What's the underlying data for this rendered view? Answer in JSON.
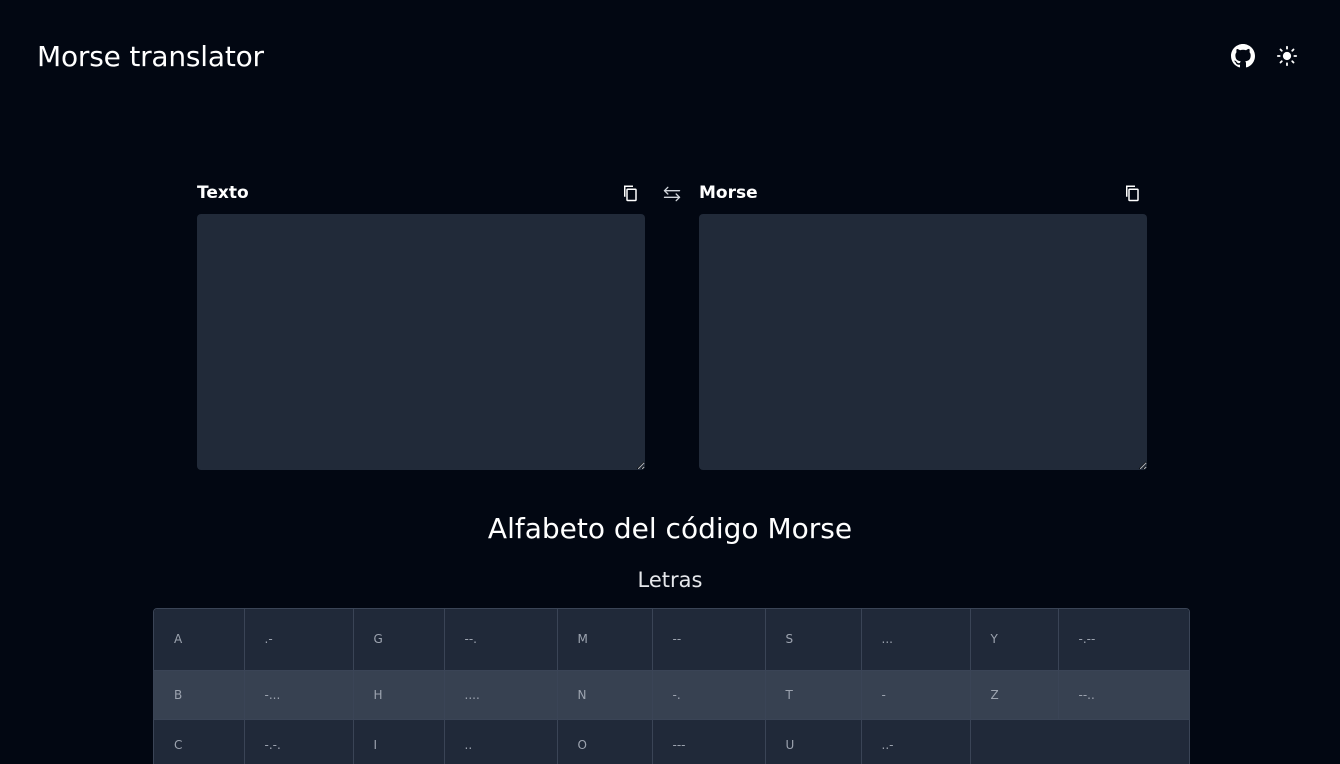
{
  "header": {
    "title": "Morse translator",
    "github_icon": "github-icon",
    "theme_icon": "sun-icon"
  },
  "translator": {
    "text_label": "Texto",
    "morse_label": "Morse",
    "text_value": "",
    "morse_value": "",
    "swap_icon": "swap-arrows-icon",
    "copy_icon": "copy-icon"
  },
  "alphabet": {
    "title": "Alfabeto del código Morse",
    "letters_title": "Letras",
    "rows": [
      [
        [
          "A",
          ".-"
        ],
        [
          "G",
          "--."
        ],
        [
          "M",
          "--"
        ],
        [
          "S",
          "..."
        ],
        [
          "Y",
          "-.--"
        ]
      ],
      [
        [
          "B",
          "-..."
        ],
        [
          "H",
          "...."
        ],
        [
          "N",
          "-."
        ],
        [
          "T",
          "-"
        ],
        [
          "Z",
          "--.."
        ]
      ],
      [
        [
          "C",
          "-.-."
        ],
        [
          "I",
          ".."
        ],
        [
          "O",
          "---"
        ],
        [
          "U",
          "..-"
        ]
      ]
    ]
  },
  "colors": {
    "background": "#020712",
    "textarea_bg": "#212a39",
    "row_bg": "#202939",
    "row_alt_bg": "#374151",
    "border": "#3a4456"
  }
}
